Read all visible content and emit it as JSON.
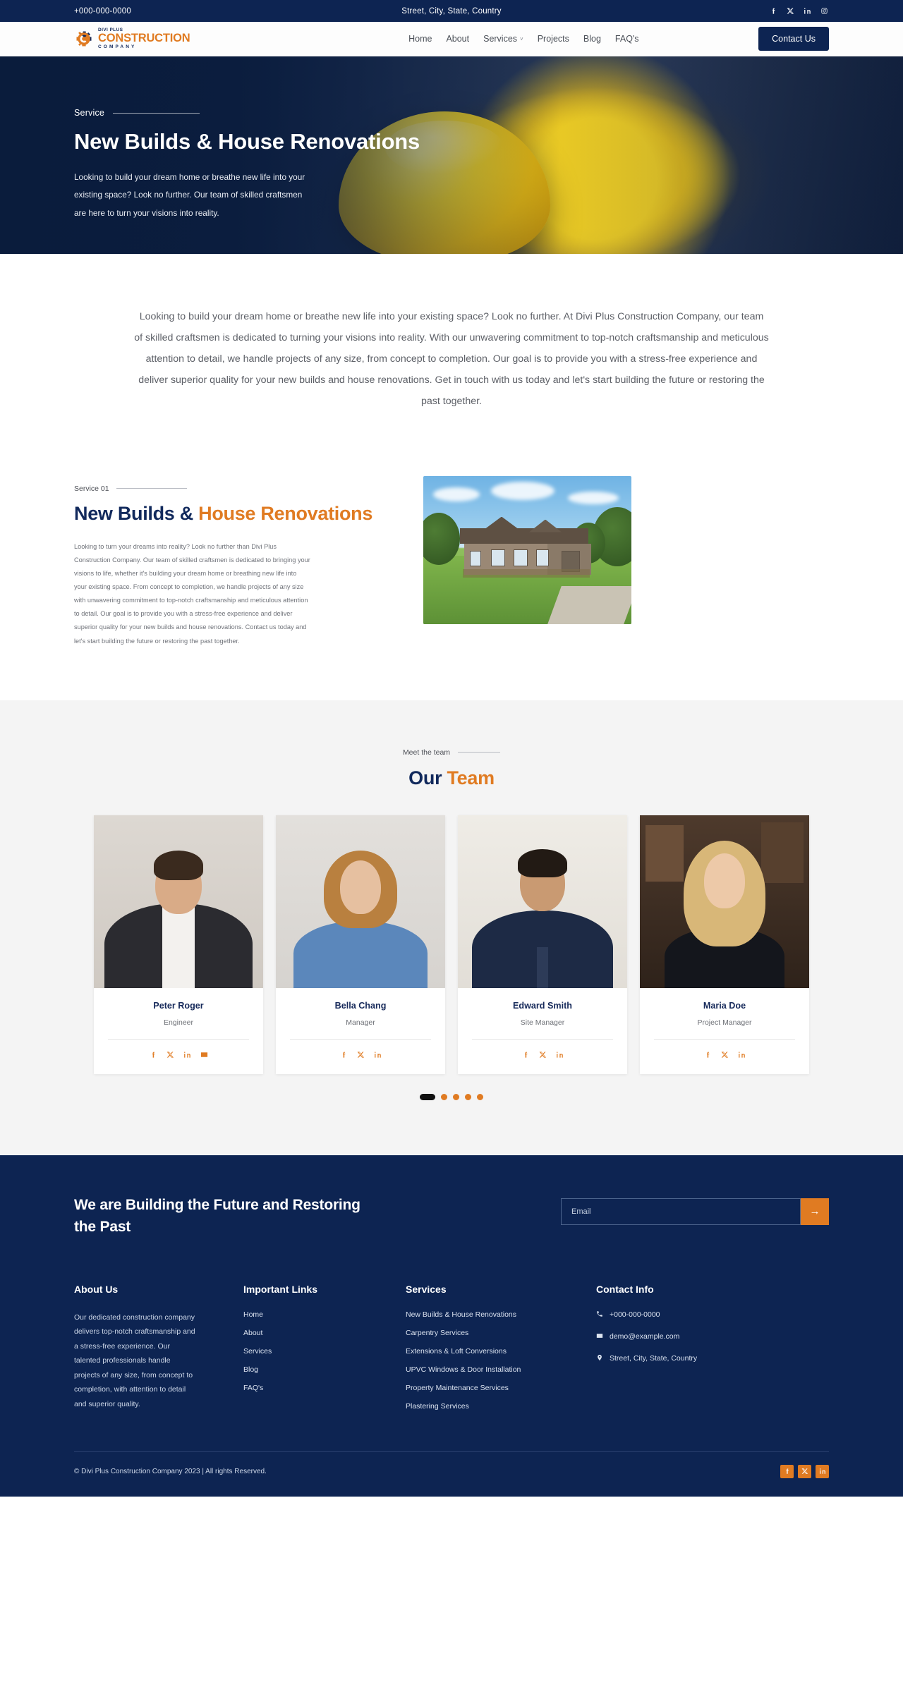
{
  "topbar": {
    "phone": "+000-000-0000",
    "address": "Street, City, State, Country",
    "social": [
      "facebook-icon",
      "x-icon",
      "linkedin-icon",
      "instagram-icon"
    ]
  },
  "logo": {
    "line1": "DIVI PLUS",
    "line2": "CONSTRUCTION",
    "line3": "COMPANY"
  },
  "nav": {
    "items": [
      {
        "label": "Home",
        "has_dropdown": false
      },
      {
        "label": "About",
        "has_dropdown": false
      },
      {
        "label": "Services",
        "has_dropdown": true
      },
      {
        "label": "Projects",
        "has_dropdown": false
      },
      {
        "label": "Blog",
        "has_dropdown": false
      },
      {
        "label": "FAQ's",
        "has_dropdown": false
      }
    ],
    "cta_label": "Contact Us",
    "caret": "˅"
  },
  "hero": {
    "eyebrow": "Service",
    "title": "New Builds & House Renovations",
    "paragraph": "Looking to build your dream home or breathe new life into your existing space? Look no further. Our team of skilled craftsmen are here to turn your visions into reality."
  },
  "intro": {
    "paragraph": "Looking to build your dream home or breathe new life into your existing space? Look no further. At Divi Plus Construction Company, our team of skilled craftsmen is dedicated to turning your visions into reality. With our unwavering commitment to top-notch craftsmanship and meticulous attention to detail, we handle projects of any size, from concept to completion. Our goal is to provide you with a stress-free experience and deliver superior quality for your new builds and house renovations. Get in touch with us today and let's start building the future or restoring the past together."
  },
  "service": {
    "eyebrow": "Service 01",
    "title_dark": "New Builds &",
    "title_accent": "House Renovations",
    "body": "Looking to turn your dreams into reality? Look no further than Divi Plus Construction Company. Our team of skilled craftsmen is dedicated to bringing your visions to life, whether it's building your dream home or breathing new life into your existing space. From concept to completion, we handle projects of any size with unwavering commitment to top-notch craftsmanship and meticulous attention to detail. Our goal is to provide you with a stress-free experience and deliver superior quality for your new builds and house renovations. Contact us today and let's start building the future or restoring the past together.",
    "image_alt": "suburban-house-photo"
  },
  "team": {
    "eyebrow": "Meet the team",
    "title_dark": "Our",
    "title_accent": "Team",
    "members": [
      {
        "name": "Peter Roger",
        "role": "Engineer",
        "social": [
          "facebook-icon",
          "x-icon",
          "linkedin-icon",
          "email-icon"
        ]
      },
      {
        "name": "Bella Chang",
        "role": "Manager",
        "social": [
          "facebook-icon",
          "x-icon",
          "linkedin-icon"
        ]
      },
      {
        "name": "Edward Smith",
        "role": "Site Manager",
        "social": [
          "facebook-icon",
          "x-icon",
          "linkedin-icon"
        ]
      },
      {
        "name": "Maria Doe",
        "role": "Project Manager",
        "social": [
          "facebook-icon",
          "x-icon",
          "linkedin-icon"
        ]
      }
    ],
    "dots": 5,
    "active_dot": 0
  },
  "cta": {
    "heading": "We are Building the Future and Restoring the Past",
    "email_placeholder": "Email",
    "email_value": "",
    "submit_icon": "→"
  },
  "footer": {
    "about": {
      "title": "About Us",
      "text": "Our dedicated construction company delivers top-notch craftsmanship and a stress-free experience. Our talented professionals handle projects of any size, from concept to completion, with attention to detail and superior quality."
    },
    "links": {
      "title": "Important Links",
      "items": [
        "Home",
        "About",
        "Services",
        "Blog",
        "FAQ's"
      ]
    },
    "services": {
      "title": "Services",
      "items": [
        "New Builds & House Renovations",
        "Carpentry Services",
        "Extensions & Loft Conversions",
        "UPVC Windows & Door Installation",
        "Property Maintenance Services",
        "Plastering Services"
      ]
    },
    "contact": {
      "title": "Contact Info",
      "items": [
        {
          "icon": "phone-icon",
          "text": "+000-000-0000"
        },
        {
          "icon": "email-icon",
          "text": "demo@example.com"
        },
        {
          "icon": "location-pin-icon",
          "text": "Street, City, State, Country"
        }
      ]
    },
    "copyright": "© Divi Plus Construction Company 2023 | All rights Reserved.",
    "social": [
      "facebook-icon",
      "x-icon",
      "linkedin-icon"
    ]
  },
  "colors": {
    "navy": "#0d2452",
    "orange": "#e07b22",
    "heading_navy": "#11295c",
    "light_gray_bg": "#f4f4f4"
  }
}
